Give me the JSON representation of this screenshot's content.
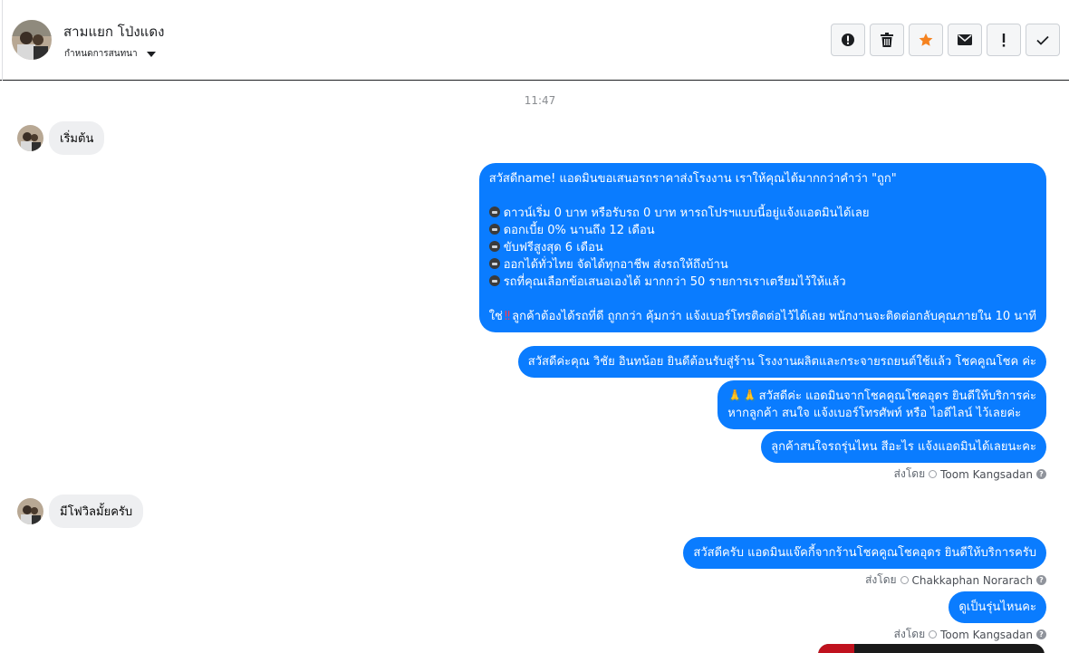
{
  "header": {
    "contact_name": "สามแยก โป่งแดง",
    "assign_label": "กำหนดการสนทนา",
    "toolbar": [
      {
        "name": "report-button",
        "icon": "exclamation-circle-icon"
      },
      {
        "name": "delete-button",
        "icon": "trash-icon"
      },
      {
        "name": "star-button",
        "icon": "star-icon",
        "color": "#f5821f"
      },
      {
        "name": "mark-unread-button",
        "icon": "envelope-icon"
      },
      {
        "name": "mark-important-button",
        "icon": "exclamation-icon"
      },
      {
        "name": "mark-done-button",
        "icon": "checkmark-icon"
      }
    ]
  },
  "conversation": {
    "timestamp": "11:47",
    "incoming_1": "เริ่มต้น",
    "outgoing_1": {
      "line_1": "สวัสดีname! แอดมินขอเสนอรถราคาส่งโรงงาน เราให้คุณได้มากกว่าคำว่า \"ถูก\"",
      "bullets": [
        "ดาวน์เริ่ม 0 บาท หรือรับรถ 0 บาท หารถโปรฯแบบนี้อยู่แจ้งแอดมินได้เลย",
        "ดอกเบี้ย 0% นานถึง 12 เดือน",
        "ขับฟรีสูงสุด 6 เดือน",
        "ออกได้ทั่วไทย จัดได้ทุกอาชีพ ส่งรถให้ถึงบ้าน",
        "รถที่คุณเลือกข้อเสนอเองได้ มากกว่า 50 รายการเราเตรียมไว้ให้แล้ว"
      ],
      "closing_prefix": "ใช่",
      "closing_text": "ลูกค้าต้องได้รถที่ดี ถูกกว่า คุ้มกว่า แจ้งเบอร์โทรติดต่อไว้ได้เลย พนักงานจะติดต่อกลับคุณภายใน 10 นาที"
    },
    "outgoing_2": "สวัสดีค่ะคุณ วิชัย อินทน้อย ยินดีต้อนรับสู่ร้าน โรงงานผลิตและกระจายรถยนต์ใช้แล้ว โชคคูณโชค ค่ะ",
    "outgoing_3": {
      "line_1": "สวัสดีค่ะ แอดมินจากโชคคูณโชคอุดร ยินดีให้บริการค่ะ",
      "line_2": "หากลูกค้า สนใจ แจ้งเบอร์โทรศัพท์ หรือ ไอดีไลน์  ไว้เลยค่ะ"
    },
    "outgoing_4": "ลูกค้าสนใจรถรุ่นไหน สีอะไร แจ้งแอดมินได้เลยนะคะ",
    "sent_by_1": {
      "label": "ส่งโดย",
      "agent": "Toom Kangsadan"
    },
    "incoming_2": "มีโฟวิลมั้ยครับ",
    "outgoing_5": "สวัสดีครับ แอดมินแจ๊คกี้จากร้านโชคคูณโชคอุดร ยินดีให้บริการครับ",
    "sent_by_2": {
      "label": "ส่งโดย",
      "agent": "Chakkaphan Norarach"
    },
    "outgoing_6": "ดูเป็นรุ่นไหนคะ",
    "sent_by_3": {
      "label": "ส่งโดย",
      "agent": "Toom Kangsadan"
    }
  },
  "colors": {
    "outgoing_bubble": "#0a7cff",
    "incoming_bubble": "#eeeff1"
  }
}
